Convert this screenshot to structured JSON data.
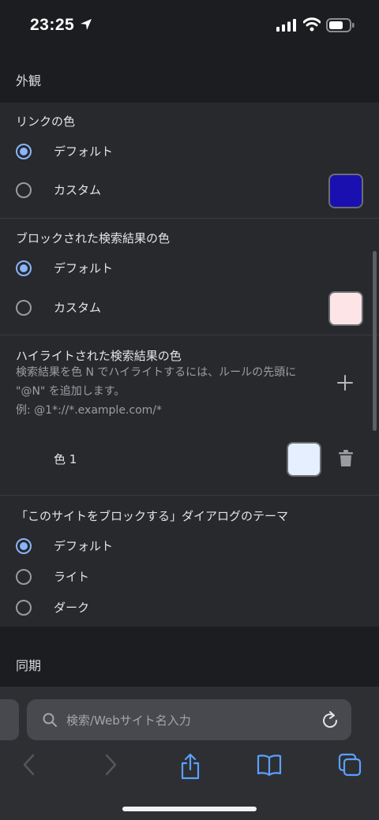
{
  "status_bar": {
    "time": "23:25"
  },
  "appearance_section": {
    "title": "外観"
  },
  "link_color": {
    "title": "リンクの色",
    "options": [
      {
        "label": "デフォルト",
        "checked": true
      },
      {
        "label": "カスタム",
        "checked": false
      }
    ],
    "custom_color": "#1a10b0"
  },
  "blocked_color": {
    "title": "ブロックされた検索結果の色",
    "options": [
      {
        "label": "デフォルト",
        "checked": true
      },
      {
        "label": "カスタム",
        "checked": false
      }
    ],
    "custom_color": "#fde4e6"
  },
  "highlight": {
    "title": "ハイライトされた検索結果の色",
    "desc_line1": "検索結果を色 N でハイライトするには、ルールの先頭に",
    "desc_line2": "\"@N\" を追加します。",
    "desc_line3": "例: @1*://*.example.com/*",
    "add_icon": "plus-icon",
    "colors": [
      {
        "label": "色 1",
        "color": "#e6efff",
        "delete_icon": "trash-icon"
      }
    ]
  },
  "dialog_theme": {
    "title": "「このサイトをブロックする」ダイアログのテーマ",
    "options": [
      {
        "label": "デフォルト",
        "checked": true
      },
      {
        "label": "ライト",
        "checked": false
      },
      {
        "label": "ダーク",
        "checked": false
      }
    ]
  },
  "sync_section": {
    "title": "同期"
  },
  "browser_bar": {
    "search_placeholder": "検索/Webサイト名入力",
    "accent_color": "#5aa0ff"
  }
}
